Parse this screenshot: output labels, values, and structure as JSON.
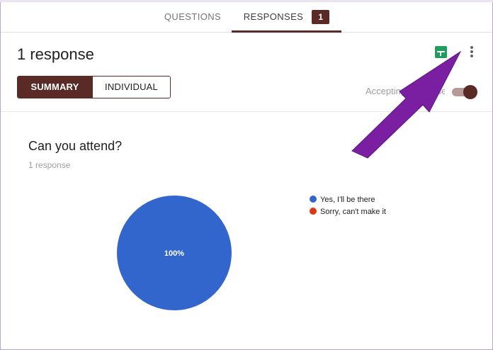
{
  "tabs": {
    "questions_label": "QUESTIONS",
    "responses_label": "RESPONSES",
    "responses_count": "1"
  },
  "header": {
    "title": "1 response",
    "sheets_icon": "google-sheets-icon",
    "more_icon": "more-vert-icon"
  },
  "view_toggle": {
    "summary_label": "SUMMARY",
    "individual_label": "INDIVIDUAL",
    "selected": "SUMMARY"
  },
  "accepting": {
    "label": "Accepting responses",
    "enabled": true
  },
  "question": {
    "title": "Can you attend?",
    "subtitle": "1 response"
  },
  "colors": {
    "accent": "#5a2a27",
    "series_yes": "#3366cc",
    "series_no": "#dc3912",
    "arrow": "#7a1fa2"
  },
  "chart_data": {
    "type": "pie",
    "categories": [
      "Yes, I'll be there",
      "Sorry, can't make it"
    ],
    "values": [
      100,
      0
    ],
    "data_labels": [
      "100%",
      ""
    ],
    "colors": [
      "#3366cc",
      "#dc3912"
    ],
    "legend_position": "right"
  }
}
